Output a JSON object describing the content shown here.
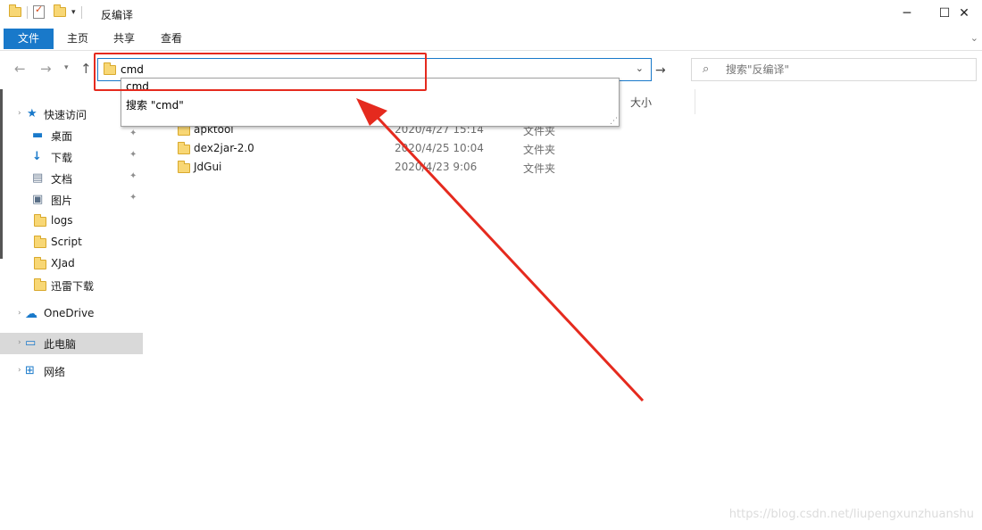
{
  "window": {
    "title": "反编译",
    "minimize_glyph": "─",
    "maximize_glyph": "☐",
    "close_glyph": "✕"
  },
  "ribbon": {
    "tabs": [
      {
        "label": "文件"
      },
      {
        "label": "主页"
      },
      {
        "label": "共享"
      },
      {
        "label": "查看"
      }
    ]
  },
  "address": {
    "value": "cmd"
  },
  "search": {
    "placeholder": "搜索\"反编译\""
  },
  "autocomplete": {
    "items": [
      {
        "label": "cmd"
      },
      {
        "label": "搜索 \"cmd\""
      }
    ]
  },
  "columns": {
    "size_header": "大小"
  },
  "sidebar": {
    "items": [
      {
        "label": "快速访问",
        "icon": "star-icon"
      },
      {
        "label": "桌面",
        "icon": "desktop-icon",
        "pinned": true
      },
      {
        "label": "下载",
        "icon": "download-icon",
        "pinned": true
      },
      {
        "label": "文档",
        "icon": "document-icon",
        "pinned": true
      },
      {
        "label": "图片",
        "icon": "pictures-icon",
        "pinned": true
      },
      {
        "label": "logs",
        "icon": "folder-icon"
      },
      {
        "label": "Script",
        "icon": "folder-icon"
      },
      {
        "label": "XJad",
        "icon": "folder-icon"
      },
      {
        "label": "迅雷下载",
        "icon": "folder-icon"
      },
      {
        "label": "OneDrive",
        "icon": "cloud-icon"
      },
      {
        "label": "此电脑",
        "icon": "computer-icon",
        "selected": true
      },
      {
        "label": "网络",
        "icon": "network-icon"
      }
    ]
  },
  "files": [
    {
      "name": "apktool",
      "date": "2020/4/27 15:14",
      "type": "文件夹"
    },
    {
      "name": "dex2jar-2.0",
      "date": "2020/4/25 10:04",
      "type": "文件夹"
    },
    {
      "name": "JdGui",
      "date": "2020/4/23 9:06",
      "type": "文件夹"
    }
  ],
  "watermark": "https://blog.csdn.net/liupengxunzhuanshu",
  "colors": {
    "accent": "#1979ca",
    "annotation_red": "#e52a1e",
    "folder_yellow": "#f8d775"
  }
}
